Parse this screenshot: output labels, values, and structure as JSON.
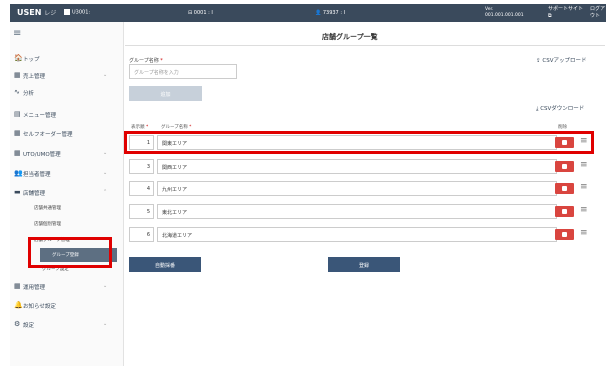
{
  "topbar": {
    "brand": "USEN",
    "brand_sub": "レジ",
    "store": "U3001:",
    "terminal": "0001 : I",
    "user": "73937 : I",
    "version_label": "Ver.",
    "version": "001.001.001.001",
    "support": "サポートサイト",
    "logout": "ログアウト"
  },
  "sidebar": {
    "items": [
      {
        "icon": "home-icon",
        "glyph": "🏠",
        "label": "トップ"
      },
      {
        "icon": "sales-icon",
        "glyph": "▦",
        "label": "売上管理"
      },
      {
        "icon": "analysis-icon",
        "glyph": "∿",
        "label": "分析"
      },
      {
        "icon": "menu-book-icon",
        "glyph": "▤",
        "label": "メニュー管理"
      },
      {
        "icon": "self-order-icon",
        "glyph": "▦",
        "label": "セルフオーダー管理"
      },
      {
        "icon": "uto-icon",
        "glyph": "▦",
        "label": "UTO/UMO管理"
      },
      {
        "icon": "staff-icon",
        "glyph": "👥",
        "label": "担当者管理"
      },
      {
        "icon": "store-icon",
        "glyph": "▬",
        "label": "店舗管理"
      },
      {
        "icon": "operation-icon",
        "glyph": "▦",
        "label": "運用管理"
      },
      {
        "icon": "notice-icon",
        "glyph": "🔔",
        "label": "お知らせ設定"
      },
      {
        "icon": "settings-icon",
        "glyph": "⚙",
        "label": "設定"
      }
    ],
    "store_sub": {
      "common": "店舗共通管理",
      "individual": "店舗個別管理",
      "group_mgmt": "店舗グループ管理",
      "group_register": "グループ登録",
      "group_settings": "グループ設定"
    }
  },
  "main": {
    "title": "店舗グループ一覧",
    "field_label": "グループ名称",
    "required_mark": "*",
    "input_placeholder": "グループ名称を入力",
    "add_button": "追加",
    "csv_upload": "CSVアップロード",
    "csv_download": "CSVダウンロード",
    "table_headers": {
      "order": "表示順",
      "name": "グループ名称",
      "delete": "削除"
    },
    "rows": [
      {
        "order": "1",
        "name": "関東エリア"
      },
      {
        "order": "3",
        "name": "関西エリア"
      },
      {
        "order": "4",
        "name": "九州エリア"
      },
      {
        "order": "5",
        "name": "東北エリア"
      },
      {
        "order": "6",
        "name": "北海道エリア"
      }
    ],
    "auto_sort_button": "自動採番",
    "register_button": "登録"
  }
}
